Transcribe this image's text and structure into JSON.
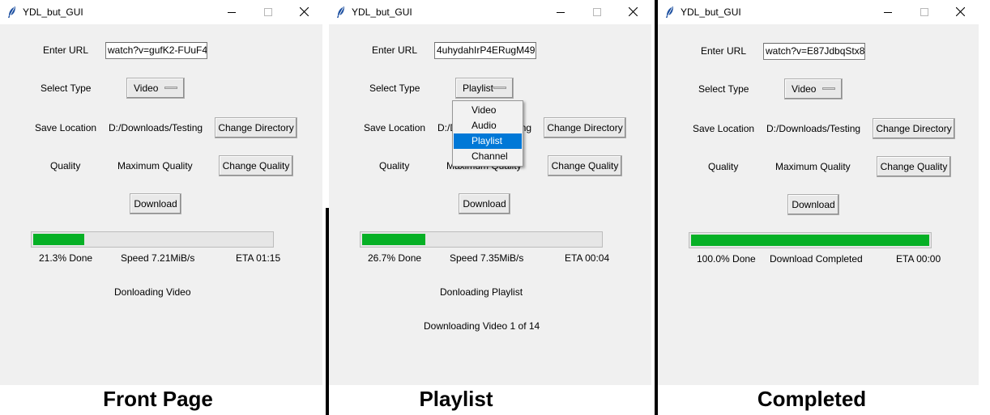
{
  "colors": {
    "progress_fill": "#06b025",
    "selection": "#0078d7"
  },
  "icons": {
    "app": "feather-icon",
    "minimize": "minimize-icon",
    "maximize": "maximize-icon",
    "close": "close-icon"
  },
  "panels": [
    {
      "title": "YDL_but_GUI",
      "labels": {
        "url": "Enter URL",
        "type": "Select Type",
        "location": "Save Location",
        "quality": "Quality"
      },
      "url_value": "watch?v=gufK2-FUuF4",
      "type_value": "Video",
      "save_location": "D:/Downloads/Testing",
      "quality_value": "Maximum Quality",
      "buttons": {
        "change_directory": "Change Directory",
        "change_quality": "Change Quality",
        "download": "Download"
      },
      "progress_percent": 21.3,
      "done_text": "21.3% Done",
      "speed_text": "Speed 7.21MiB/s",
      "eta_text": "ETA 01:15",
      "status_text": "Donloading Video",
      "status2_text": "",
      "caption": "Front Page"
    },
    {
      "title": "YDL_but_GUI",
      "labels": {
        "url": "Enter URL",
        "type": "Select Type",
        "location": "Save Location",
        "quality": "Quality"
      },
      "url_value": "4uhydahIrP4ERugM49",
      "type_value": "Playlist",
      "save_location": "D:/Downloads/Testing",
      "quality_value": "Maximum Quality",
      "buttons": {
        "change_directory": "Change Directory",
        "change_quality": "Change Quality",
        "download": "Download"
      },
      "progress_percent": 26.7,
      "done_text": "26.7% Done",
      "speed_text": "Speed 7.35MiB/s",
      "eta_text": "ETA 00:04",
      "status_text": "Donloading Playlist",
      "status2_text": "Downloading Video 1 of 14",
      "caption": "Playlist",
      "dropdown": {
        "options": [
          "Video",
          "Audio",
          "Playlist",
          "Channel"
        ],
        "highlighted": "Playlist"
      }
    },
    {
      "title": "YDL_but_GUI",
      "labels": {
        "url": "Enter URL",
        "type": "Select Type",
        "location": "Save Location",
        "quality": "Quality"
      },
      "url_value": "watch?v=E87JdbqStx8",
      "type_value": "Video",
      "save_location": "D:/Downloads/Testing",
      "quality_value": "Maximum Quality",
      "buttons": {
        "change_directory": "Change Directory",
        "change_quality": "Change Quality",
        "download": "Download"
      },
      "progress_percent": 100.0,
      "done_text": "100.0% Done",
      "speed_text": "Download Completed",
      "eta_text": "ETA 00:00",
      "status_text": "",
      "status2_text": "",
      "caption": "Completed"
    }
  ]
}
